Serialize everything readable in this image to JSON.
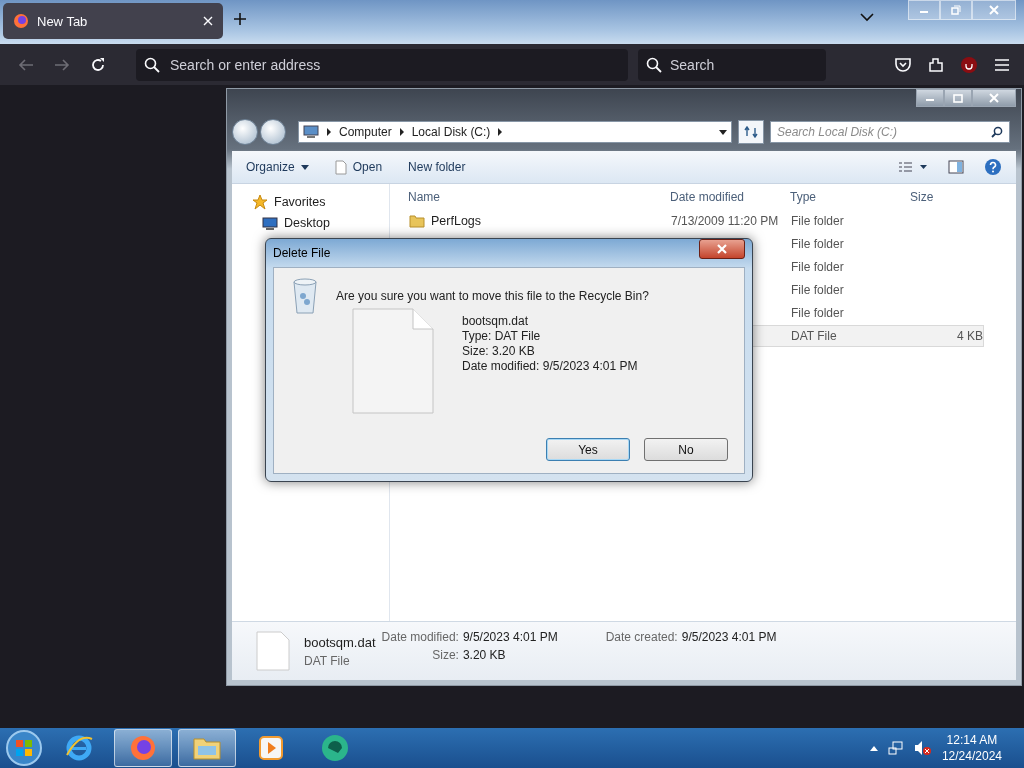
{
  "browser": {
    "tab": {
      "title": "New Tab",
      "selected": true
    },
    "address_placeholder": "Search or enter address",
    "search_placeholder": "Search"
  },
  "explorer": {
    "breadcrumbs": [
      "Computer",
      "Local Disk (C:)"
    ],
    "search_placeholder": "Search Local Disk (C:)",
    "toolbar": [
      {
        "label": "Organize",
        "kind": "menu"
      },
      {
        "label": "Open",
        "kind": "open"
      },
      {
        "label": "New folder",
        "kind": "plain"
      }
    ],
    "nav": [
      {
        "label": "Favorites",
        "kind": "group"
      },
      {
        "label": "Desktop",
        "kind": "desktop"
      }
    ],
    "columns": [
      "Name",
      "Date modified",
      "Type",
      "Size"
    ],
    "rows": [
      {
        "name": "PerfLogs",
        "date_modified": "7/13/2009 11:20 PM",
        "type": "File folder",
        "kind": "folder",
        "selected": false
      },
      {
        "type": "File folder",
        "selected": false
      },
      {
        "type": "File folder",
        "selected": false
      },
      {
        "type": "File folder",
        "selected": false
      },
      {
        "type": "File folder",
        "selected": false
      },
      {
        "type": "DAT File",
        "size": "4 KB",
        "selected": true
      }
    ],
    "details": {
      "name": "bootsqm.dat",
      "type": "DAT File",
      "fields": [
        {
          "label": "Date modified:",
          "value": "9/5/2023 4:01 PM"
        },
        {
          "label": "Size:",
          "value": "3.20 KB"
        },
        {
          "label": "Date created:",
          "value": "9/5/2023 4:01 PM"
        }
      ]
    }
  },
  "dialog": {
    "title": "Delete File",
    "question": "Are you sure you want to move this file to the Recycle Bin?",
    "file_name": "bootsqm.dat",
    "lines": [
      "Type: DAT File",
      "Size: 3.20 KB",
      "Date modified: 9/5/2023 4:01 PM"
    ],
    "buttons": [
      {
        "label": "Yes",
        "selected": true
      },
      {
        "label": "No",
        "selected": false
      }
    ]
  },
  "taskbar": {
    "apps": [
      {
        "kind": "ie",
        "selected": false
      },
      {
        "kind": "firefox",
        "selected": true
      },
      {
        "kind": "explorer",
        "selected": true
      },
      {
        "kind": "media",
        "selected": false
      },
      {
        "kind": "green",
        "selected": false
      }
    ],
    "time": "12:14 AM",
    "date": "12/24/2024"
  }
}
